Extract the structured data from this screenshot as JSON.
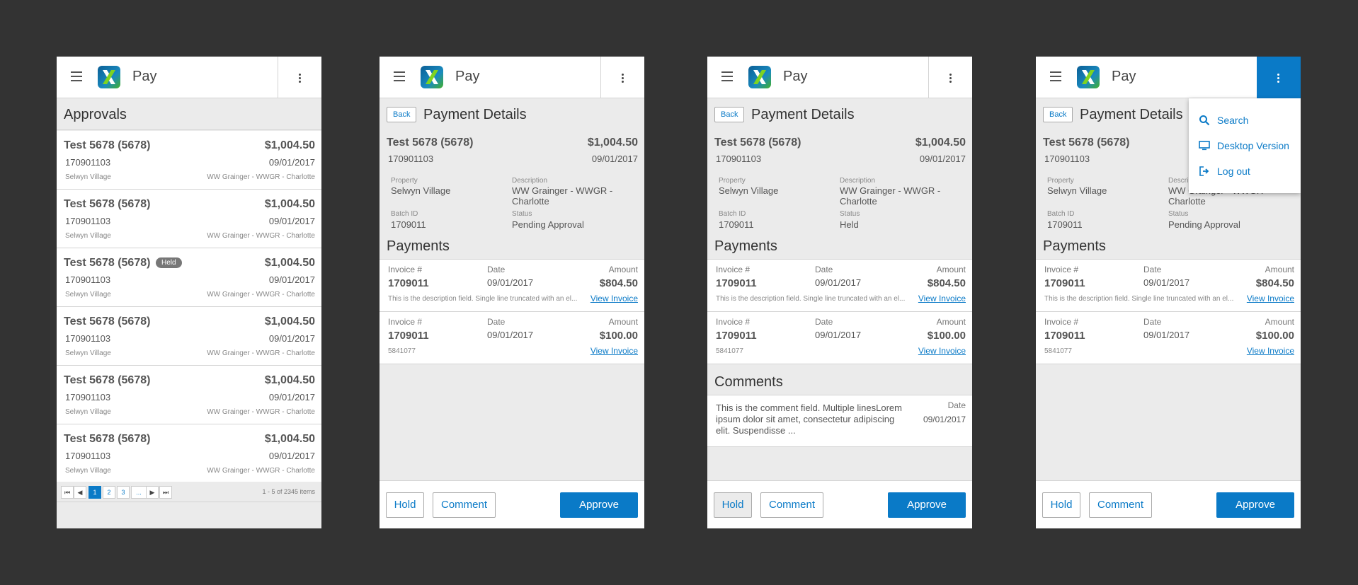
{
  "app": {
    "title": "Pay"
  },
  "screen1": {
    "header": "Approvals",
    "rows": [
      {
        "name": "Test 5678 (5678)",
        "amount": "$1,004.50",
        "id": "170901103",
        "date": "09/01/2017",
        "property": "Selwyn Village",
        "description": "WW Grainger - WWGR - Charlotte",
        "badge": ""
      },
      {
        "name": "Test 5678 (5678)",
        "amount": "$1,004.50",
        "id": "170901103",
        "date": "09/01/2017",
        "property": "Selwyn Village",
        "description": "WW Grainger - WWGR - Charlotte",
        "badge": ""
      },
      {
        "name": "Test 5678 (5678)",
        "amount": "$1,004.50",
        "id": "170901103",
        "date": "09/01/2017",
        "property": "Selwyn Village",
        "description": "WW Grainger - WWGR - Charlotte",
        "badge": "Held"
      },
      {
        "name": "Test 5678 (5678)",
        "amount": "$1,004.50",
        "id": "170901103",
        "date": "09/01/2017",
        "property": "Selwyn Village",
        "description": "WW Grainger - WWGR - Charlotte",
        "badge": ""
      },
      {
        "name": "Test 5678 (5678)",
        "amount": "$1,004.50",
        "id": "170901103",
        "date": "09/01/2017",
        "property": "Selwyn Village",
        "description": "WW Grainger - WWGR - Charlotte",
        "badge": ""
      },
      {
        "name": "Test 5678 (5678)",
        "amount": "$1,004.50",
        "id": "170901103",
        "date": "09/01/2017",
        "property": "Selwyn Village",
        "description": "WW Grainger - WWGR - Charlotte",
        "badge": ""
      }
    ],
    "pager": {
      "first": "⏮",
      "prev": "◀",
      "pages": [
        "1",
        "2",
        "3",
        "..."
      ],
      "current": "1",
      "next": "▶",
      "last": "⏭",
      "info": "1 - 5 of 2345 items"
    }
  },
  "detail": {
    "back_label": "Back",
    "title": "Payment Details",
    "name": "Test 5678 (5678)",
    "amount": "$1,004.50",
    "id": "170901103",
    "date": "09/01/2017",
    "property_label": "Property",
    "property": "Selwyn Village",
    "description_label": "Description",
    "description": "WW Grainger - WWGR - Charlotte",
    "batch_label": "Batch ID",
    "batch": "1709011",
    "status_label": "Status",
    "payments_title": "Payments",
    "payments": [
      {
        "invoice_label": "Invoice #",
        "date_label": "Date",
        "amount_label": "Amount",
        "invoice": "1709011",
        "date": "09/01/2017",
        "amount": "$804.50",
        "sub": "This is the description field. Single line truncated with an el...",
        "link": "View Invoice"
      },
      {
        "invoice_label": "Invoice #",
        "date_label": "Date",
        "amount_label": "Amount",
        "invoice": "1709011",
        "date": "09/01/2017",
        "amount": "$100.00",
        "sub": "5841077",
        "link": "View Invoice"
      }
    ],
    "actions": {
      "hold": "Hold",
      "comment": "Comment",
      "approve": "Approve"
    }
  },
  "screen2": {
    "status": "Pending Approval"
  },
  "screen3": {
    "status": "Held",
    "comments_title": "Comments",
    "comment": {
      "text": "This is the comment field. Multiple linesLorem ipsum dolor sit amet, consectetur adipiscing elit. Suspendisse ...",
      "date_label": "Date",
      "date": "09/01/2017"
    }
  },
  "screen4": {
    "status": "Pending Approval",
    "menu": [
      {
        "icon": "search-icon",
        "label": "Search"
      },
      {
        "icon": "desktop-icon",
        "label": "Desktop Version"
      },
      {
        "icon": "logout-icon",
        "label": "Log out"
      }
    ]
  },
  "colors": {
    "background": "#333333",
    "screen": "#ebebeb",
    "accent": "#0a7ac7",
    "badge": "#777777"
  }
}
